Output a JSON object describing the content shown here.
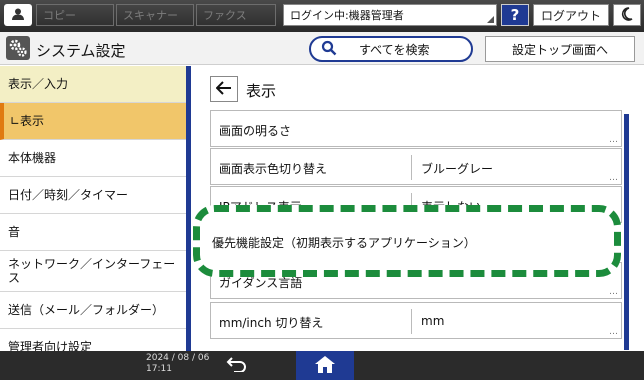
{
  "topbar": {
    "tabs": [
      "コピー",
      "スキャナー",
      "ファクス"
    ],
    "login_status": "ログイン中:機器管理者",
    "help_label": "?",
    "logout_label": "ログアウト"
  },
  "header": {
    "title": "システム設定",
    "search_label": "すべてを検索",
    "top_settings_label": "設定トップ画面へ"
  },
  "sidebar": {
    "items": [
      {
        "label": "表示／入力"
      },
      {
        "label": "∟表示"
      },
      {
        "label": "本体機器"
      },
      {
        "label": "日付／時刻／タイマー"
      },
      {
        "label": "音"
      },
      {
        "label": "ネットワーク／インターフェース"
      },
      {
        "label": "送信（メール／フォルダー）"
      },
      {
        "label": "管理者向け設定"
      }
    ]
  },
  "main": {
    "title": "表示",
    "rows": [
      {
        "label": "画面の明るさ",
        "value": ""
      },
      {
        "label": "画面表示色切り替え",
        "value": "ブルーグレー"
      },
      {
        "label": "IPアドレス表示",
        "value": "表示しない"
      },
      {
        "label": "優先機能設定（初期表示するアプリケーション）",
        "value": ""
      },
      {
        "label": "ガイダンス言語",
        "value": ""
      },
      {
        "label": "mm/inch 切り替え",
        "value": "mm"
      }
    ]
  },
  "bottombar": {
    "date": "2024 / 08 / 06",
    "time": "17:11"
  },
  "colors": {
    "accent_blue": "#1f3a93",
    "highlight_green": "#1c8c3c",
    "active_category": "#f3efc5",
    "active_subitem": "#f1c66a"
  }
}
